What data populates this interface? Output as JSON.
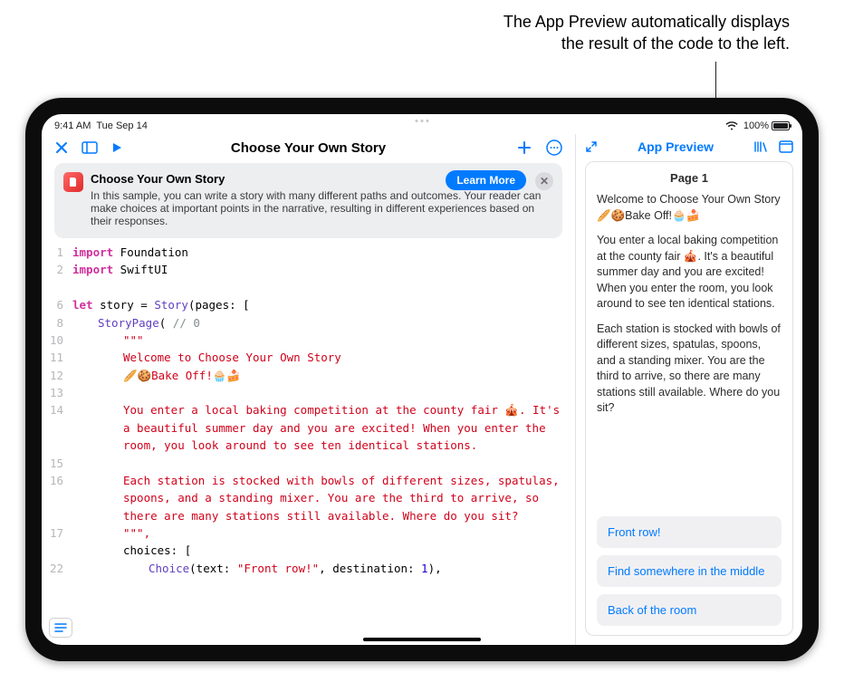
{
  "callout": {
    "line1": "The App Preview automatically displays",
    "line2": "the result of the code to the left."
  },
  "statusbar": {
    "time": "9:41 AM",
    "date": "Tue Sep 14",
    "battery_pct": "100%"
  },
  "editor": {
    "title": "Choose Your Own Story",
    "card": {
      "heading": "Choose Your Own Story",
      "body": "In this sample, you can write a story with many different paths and outcomes. Your reader can make choices at important points in the narrative, resulting in different experiences based on their responses.",
      "learn_more": "Learn More"
    },
    "code": {
      "l1_kw": "import",
      "l1_id": " Foundation",
      "l2_kw": "import",
      "l2_id": " SwiftUI",
      "l6a": "let",
      "l6b": " story = ",
      "l6c": "Story",
      "l6d": "(pages: [",
      "l8a": "StoryPage",
      "l8b": "( ",
      "l8c": "// 0",
      "l10": "\"\"\"",
      "l11": "Welcome to Choose Your Own Story",
      "l12": "🥖🍪Bake Off!🧁🍰",
      "l14": "You enter a local baking competition at the county fair 🎪. It's a beautiful summer day and you are excited! When you enter the room, you look around to see ten identical stations.",
      "l16": "Each station is stocked with bowls of different sizes, spatulas, spoons, and a standing mixer. You are the third to arrive, so there are many stations still available. Where do you sit?",
      "l17": "\"\"\",",
      "l18": "choices: [",
      "l22a": "Choice",
      "l22b": "(text: ",
      "l22c": "\"Front row!\"",
      "l22d": ", destination: ",
      "l22e": "1",
      "l22f": "),"
    }
  },
  "preview": {
    "toolbar_title": "App Preview",
    "page_title": "Page 1",
    "p1": "Welcome to Choose Your Own Story 🥖🍪Bake Off!🧁🍰",
    "p2": "You enter a local baking competition at the county fair 🎪. It's a beautiful summer day and you are excited! When you enter the room, you look around to see ten identical stations.",
    "p3": "Each station is stocked with bowls of different sizes, spatulas, spoons, and a standing mixer. You are the third to arrive, so there are many stations still available. Where do you sit?",
    "choices": {
      "c1": "Front row!",
      "c2": "Find somewhere in the middle",
      "c3": "Back of the room"
    }
  }
}
